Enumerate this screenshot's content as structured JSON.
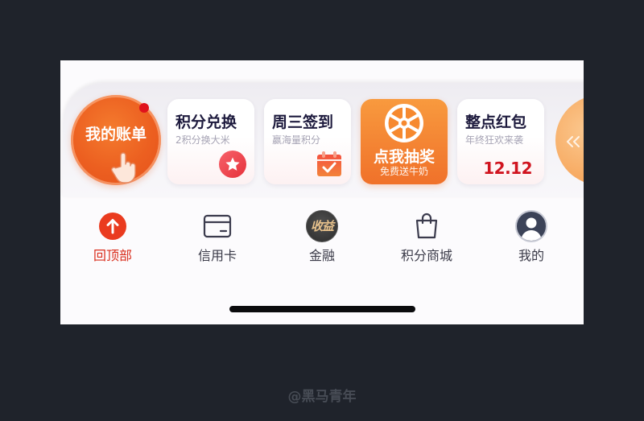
{
  "bill": {
    "label": "我的账单",
    "icon": "pointing-hand-icon",
    "notification": "red-dot"
  },
  "cards": [
    {
      "title": "积分兑换",
      "subtitle": "2积分换大米",
      "icon": "star-icon"
    },
    {
      "title": "周三签到",
      "subtitle": "赢海量积分",
      "icon": "calendar-check-icon"
    },
    {
      "title": "点我抽奖",
      "subtitle": "免费送牛奶",
      "icon": "lucky-wheel-icon"
    },
    {
      "title": "整点红包",
      "subtitle": "年终狂欢来袭",
      "badge": "12.12"
    }
  ],
  "more": {
    "icon": "double-chevron-left-icon"
  },
  "tabs": [
    {
      "label": "回顶部",
      "icon": "arrow-up-icon",
      "active": true
    },
    {
      "label": "信用卡",
      "icon": "credit-card-icon"
    },
    {
      "label": "金融",
      "icon": "earnings-icon",
      "badge": "收益"
    },
    {
      "label": "积分商城",
      "icon": "shopping-bag-icon"
    },
    {
      "label": "我的",
      "icon": "avatar-icon"
    }
  ],
  "watermark": "@黑马青年",
  "colors": {
    "background": "#1f232b",
    "accent": "#ef6422",
    "active_tab": "#d92d1c",
    "title": "#1d1a3d",
    "festival_red": "#d0141f"
  }
}
